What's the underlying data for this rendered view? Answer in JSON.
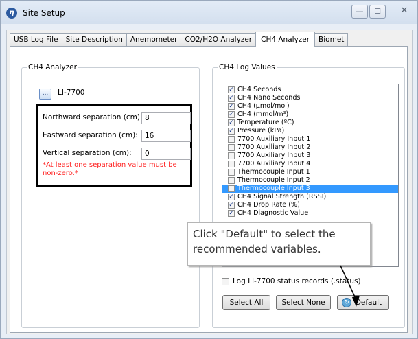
{
  "window": {
    "title": "Site Setup",
    "app_icon": "licor-logo-icon",
    "minimize": "—",
    "maximize": "☐",
    "close": "✕"
  },
  "tabs": [
    {
      "label": "USB Log File"
    },
    {
      "label": "Site Description"
    },
    {
      "label": "Anemometer"
    },
    {
      "label": "CO2/H2O Analyzer"
    },
    {
      "label": "CH4 Analyzer",
      "active": true
    },
    {
      "label": "Biomet"
    }
  ],
  "analyzer": {
    "group_title": "CH4 Analyzer",
    "browse_label": "...",
    "device": "LI-7700",
    "northward_label": "Northward separation (cm):",
    "northward_value": "8",
    "eastward_label": "Eastward separation (cm):",
    "eastward_value": "16",
    "vertical_label": "Vertical separation (cm):",
    "vertical_value": "0",
    "warning": "*At least one separation value must be non-zero.*"
  },
  "log_values": {
    "group_title": "CH4 Log Values",
    "items": [
      {
        "label": "CH4 Seconds",
        "checked": true
      },
      {
        "label": "CH4 Nano Seconds",
        "checked": true
      },
      {
        "label": "CH4 (µmol/mol)",
        "checked": true
      },
      {
        "label": "CH4 (mmol/m³)",
        "checked": true
      },
      {
        "label": "Temperature (ºC)",
        "checked": true
      },
      {
        "label": "Pressure (kPa)",
        "checked": true
      },
      {
        "label": "7700 Auxiliary Input 1",
        "checked": false
      },
      {
        "label": "7700 Auxiliary Input 2",
        "checked": false
      },
      {
        "label": "7700 Auxiliary Input 3",
        "checked": false
      },
      {
        "label": "7700 Auxiliary Input 4",
        "checked": false
      },
      {
        "label": "Thermocouple Input 1",
        "checked": false
      },
      {
        "label": "Thermocouple Input 2",
        "checked": false
      },
      {
        "label": "Thermocouple Input 3",
        "checked": false,
        "selected": true
      },
      {
        "label": "CH4 Signal Strength (RSSI)",
        "checked": true
      },
      {
        "label": "CH4 Drop Rate (%)",
        "checked": true
      },
      {
        "label": "CH4 Diagnostic Value",
        "checked": true
      }
    ],
    "status_records_label": "Log LI-7700 status records (.status)",
    "status_records_checked": false,
    "select_all_label": "Select All",
    "select_none_label": "Select None",
    "default_label": "Default"
  },
  "callout": {
    "line1": "Click \"Default\" to select the",
    "line2": "recommended variables."
  }
}
